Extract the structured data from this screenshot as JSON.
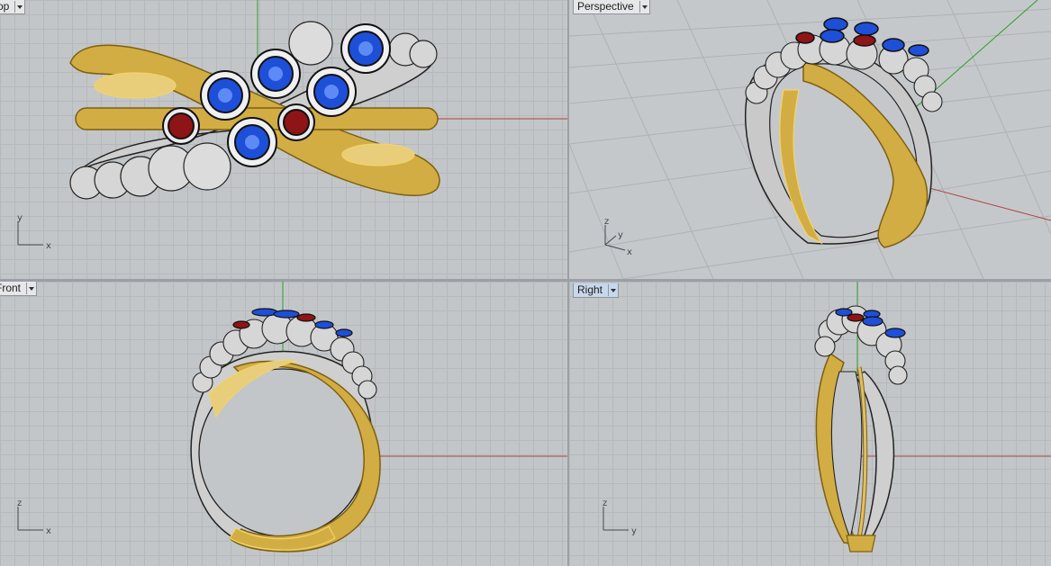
{
  "viewports": {
    "top": {
      "label": "Top",
      "axes": [
        "y",
        "x"
      ]
    },
    "perspective": {
      "label": "Perspective",
      "axes": [
        "z",
        "y",
        "x"
      ]
    },
    "front": {
      "label": "Front",
      "axes": [
        "z",
        "x"
      ]
    },
    "right": {
      "label": "Right",
      "axes": [
        "z",
        "y"
      ]
    }
  },
  "colors": {
    "gold": "#d4b04a",
    "gold_dark": "#9c7c22",
    "silver": "#c9c9c9",
    "silver_dark": "#8a8a8a",
    "sapphire": "#1e4fd8",
    "ruby": "#8e1416",
    "x_axis": "#b04040",
    "y_axis": "#2ea02e",
    "active_tab": "#c8d8ec"
  },
  "icons": [
    "dropdown-arrow-icon",
    "axis-widget-icon"
  ]
}
